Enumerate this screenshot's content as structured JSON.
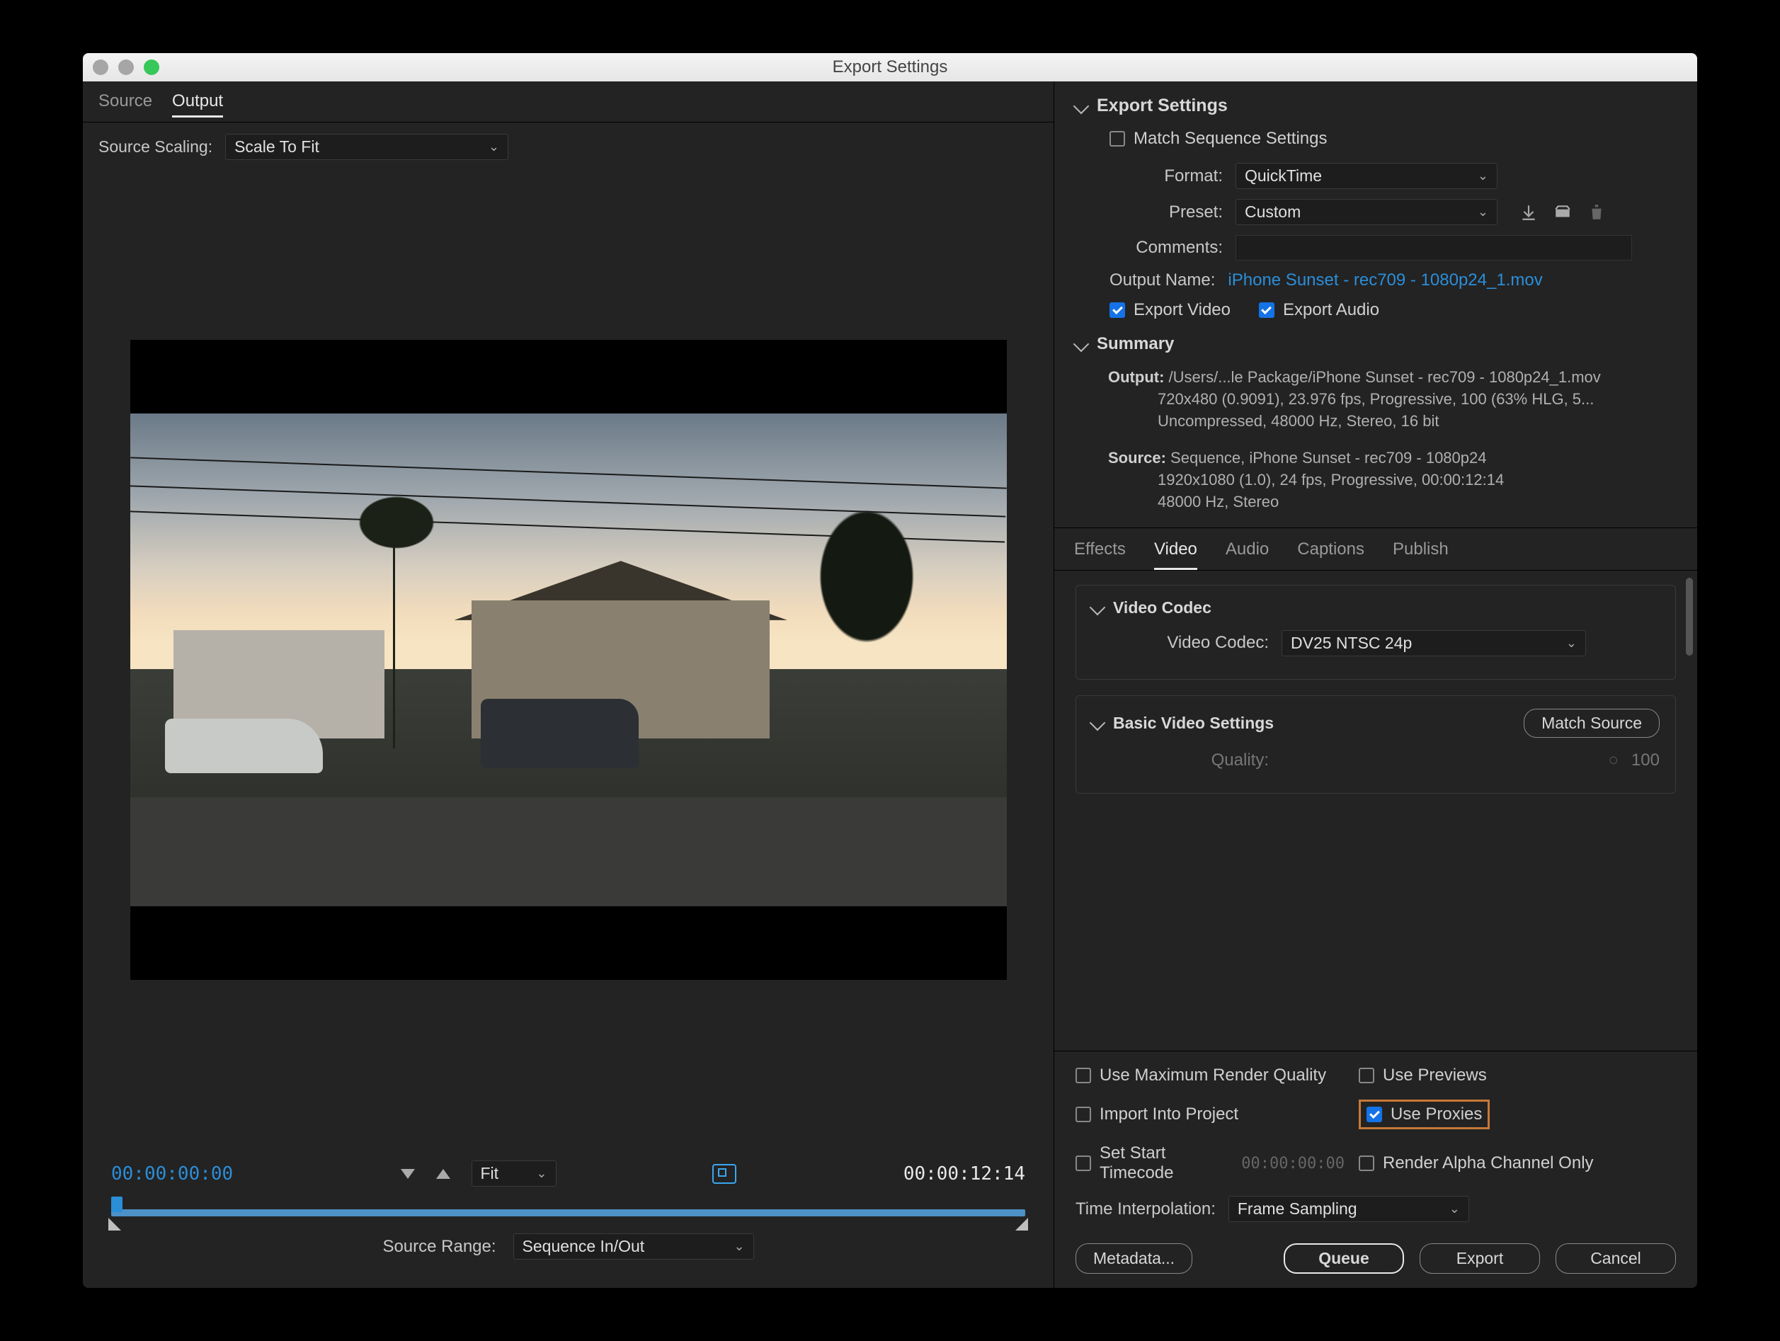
{
  "window": {
    "title": "Export Settings"
  },
  "leftTabs": {
    "source": "Source",
    "output": "Output"
  },
  "sourceScaling": {
    "label": "Source Scaling:",
    "value": "Scale To Fit"
  },
  "transport": {
    "current": "00:00:00:00",
    "end": "00:00:12:14",
    "zoom": "Fit",
    "sourceRangeLabel": "Source Range:",
    "sourceRangeValue": "Sequence In/Out"
  },
  "exportSettings": {
    "heading": "Export Settings",
    "matchSequence": "Match Sequence Settings",
    "formatLabel": "Format:",
    "formatValue": "QuickTime",
    "presetLabel": "Preset:",
    "presetValue": "Custom",
    "commentsLabel": "Comments:",
    "outputNameLabel": "Output Name:",
    "outputNameValue": "iPhone Sunset - rec709 - 1080p24_1.mov",
    "exportVideo": "Export Video",
    "exportAudio": "Export Audio"
  },
  "summary": {
    "heading": "Summary",
    "outLabel": "Output:",
    "out1": "/Users/...le Package/iPhone Sunset - rec709 - 1080p24_1.mov",
    "out2": "720x480 (0.9091), 23.976 fps, Progressive, 100 (63% HLG, 5...",
    "out3": "Uncompressed, 48000 Hz, Stereo, 16 bit",
    "srcLabel": "Source:",
    "src1": "Sequence, iPhone Sunset - rec709 - 1080p24",
    "src2": "1920x1080 (1.0), 24 fps, Progressive, 00:00:12:14",
    "src3": "48000 Hz, Stereo"
  },
  "settingsTabs": {
    "effects": "Effects",
    "video": "Video",
    "audio": "Audio",
    "captions": "Captions",
    "publish": "Publish"
  },
  "videoCodec": {
    "heading": "Video Codec",
    "label": "Video Codec:",
    "value": "DV25 NTSC 24p"
  },
  "basicVideo": {
    "heading": "Basic Video Settings",
    "matchSource": "Match Source",
    "qualityLabel": "Quality:",
    "qualityValue": "100"
  },
  "bottom": {
    "maxRender": "Use Maximum Render Quality",
    "usePreviews": "Use Previews",
    "importProject": "Import Into Project",
    "useProxies": "Use Proxies",
    "setStartTC": "Set Start Timecode",
    "startTCValue": "00:00:00:00",
    "renderAlpha": "Render Alpha Channel Only",
    "timeInterpLabel": "Time Interpolation:",
    "timeInterpValue": "Frame Sampling"
  },
  "buttons": {
    "metadata": "Metadata...",
    "queue": "Queue",
    "export": "Export",
    "cancel": "Cancel"
  }
}
